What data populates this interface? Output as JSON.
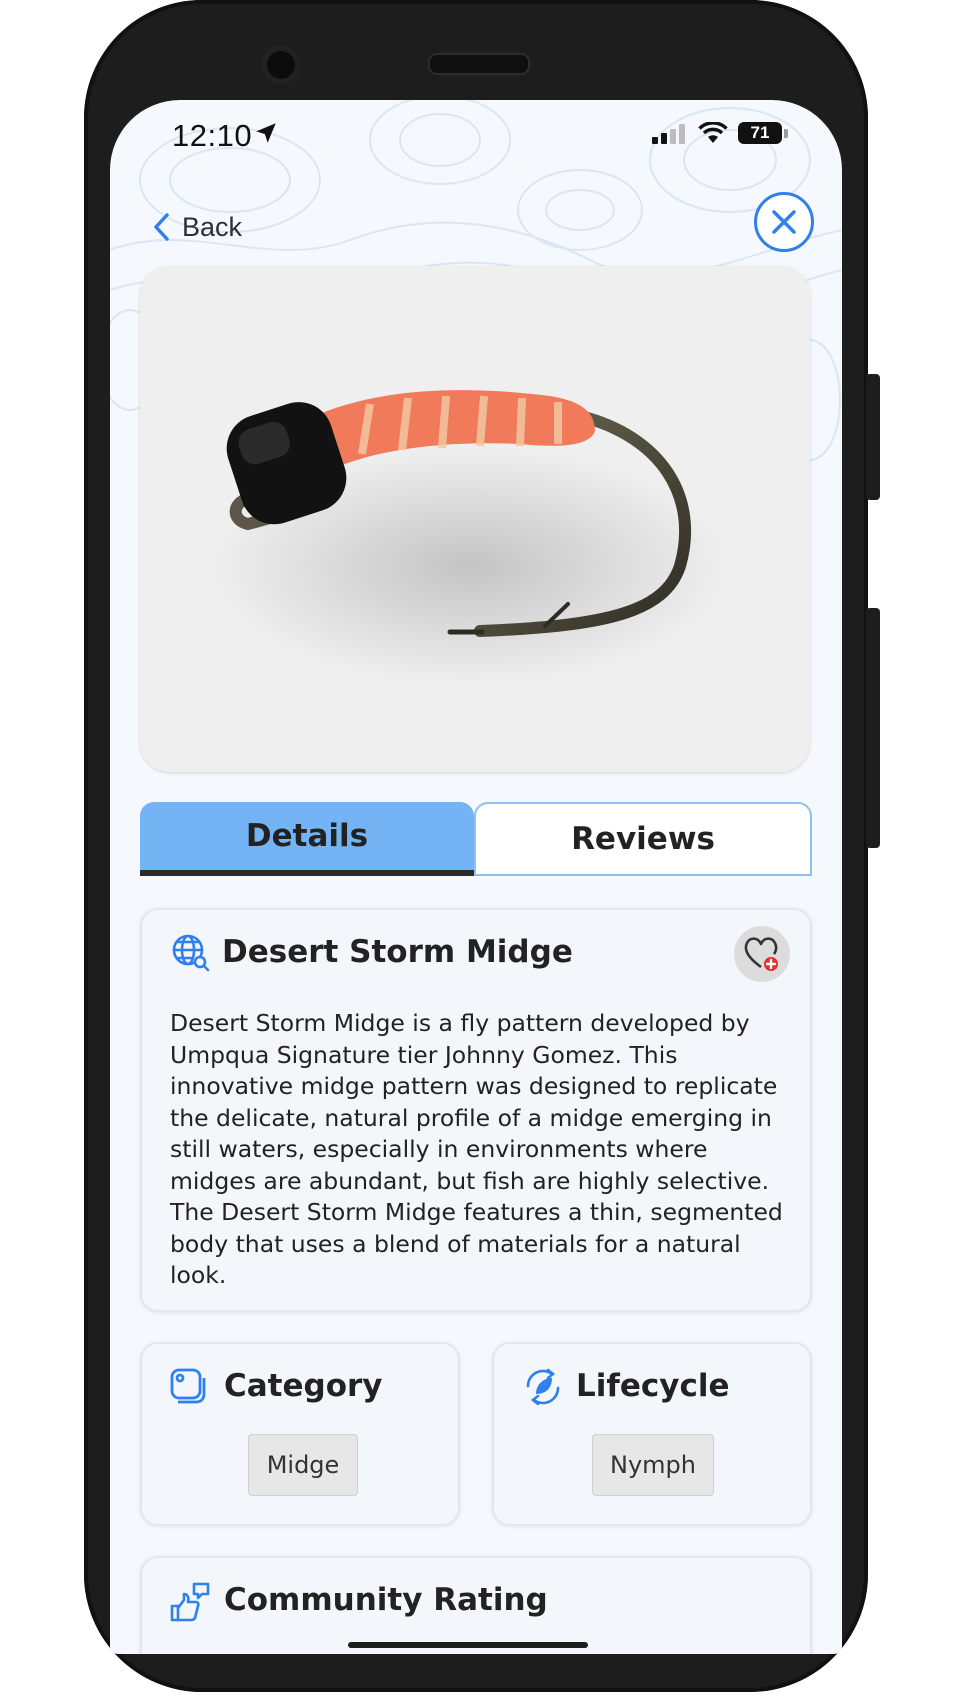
{
  "status_bar": {
    "time": "12:10",
    "battery": "71"
  },
  "nav": {
    "back_label": "Back"
  },
  "tabs": [
    {
      "label": "Details",
      "active": true
    },
    {
      "label": "Reviews",
      "active": false
    }
  ],
  "fly": {
    "name": "Desert Storm Midge",
    "description": "Desert Storm Midge is a fly pattern developed by Umpqua Signature tier Johnny Gomez. This innovative midge pattern was designed to replicate the delicate, natural profile of a midge emerging in still waters, especially in environments where midges are abundant, but fish are highly selective. The Desert Storm Midge features a thin, segmented body that uses a blend of materials for a natural look."
  },
  "category": {
    "title": "Category",
    "value": "Midge"
  },
  "lifecycle": {
    "title": "Lifecycle",
    "value": "Nymph"
  },
  "rating": {
    "title": "Community Rating"
  },
  "colors": {
    "accent": "#2f80ed",
    "tab_active": "#74b4f5",
    "fly_body": "#f07a5a",
    "bead": "#111111"
  },
  "icons": {
    "back": "chevron-left-icon",
    "close": "close-icon",
    "globe": "globe-search-icon",
    "favorite": "heart-add-icon",
    "category": "tag-icon",
    "lifecycle": "cycle-icon",
    "rating": "thumbs-icon"
  }
}
